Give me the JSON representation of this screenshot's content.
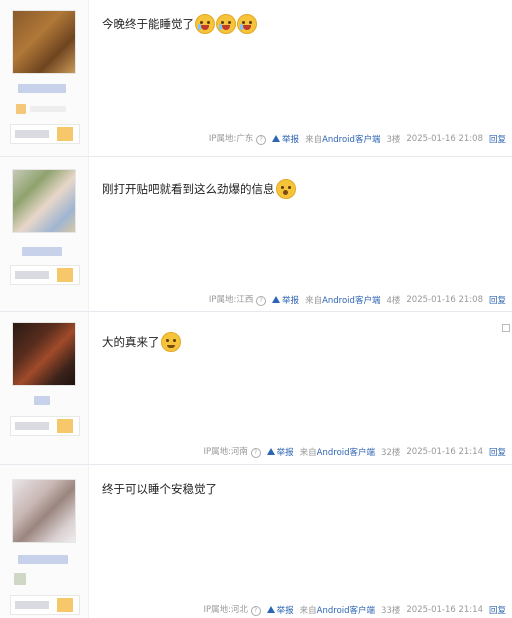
{
  "posts": [
    {
      "content": "今晚终于能睡觉了",
      "emojis": [
        "crying-face-icon",
        "crying-face-icon",
        "crying-face-icon"
      ],
      "ip": "IP属地:广东",
      "report": "举报",
      "source": "来自Android客户端",
      "floor": "3楼",
      "time": "2025-01-16 21:08",
      "reply": "回复"
    },
    {
      "content": "刚打开贴吧就看到这么劲爆的信息",
      "emojis": [
        "surprised-face-icon"
      ],
      "ip": "IP属地:江西",
      "report": "举报",
      "source": "来自Android客户端",
      "floor": "4楼",
      "time": "2025-01-16 21:08",
      "reply": "回复"
    },
    {
      "content": "大的真来了",
      "emojis": [
        "grinning-face-icon"
      ],
      "ip": "IP属地:河南",
      "report": "举报",
      "source": "来自Android客户端",
      "floor": "32楼",
      "time": "2025-01-16 21:14",
      "reply": "回复"
    },
    {
      "content": "终于可以睡个安稳觉了",
      "emojis": [],
      "ip": "IP属地:河北",
      "report": "举报",
      "source": "来自Android客户端",
      "floor": "33楼",
      "time": "2025-01-16 21:14",
      "reply": "回复"
    }
  ],
  "colors": {
    "link": "#2d64b3",
    "meta": "#999999",
    "badge": "#f6c86b"
  }
}
